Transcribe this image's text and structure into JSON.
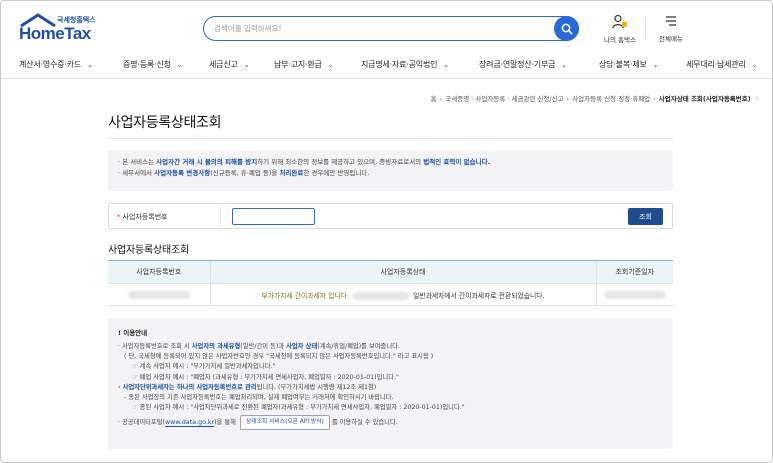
{
  "header": {
    "logo_small": "국세청홈택스",
    "logo_big": "HomeTax",
    "search_placeholder": "검색어를 입력하세요!",
    "my_hometax_label": "나의 홈택스",
    "all_menu_label": "전체메뉴"
  },
  "nav": {
    "items": [
      {
        "label": "계산서·영수증·카드"
      },
      {
        "label": "증명·등록·신청"
      },
      {
        "label": "세금신고"
      },
      {
        "label": "납부·고지·환급"
      },
      {
        "label": "지급명세·자료·공익법인"
      },
      {
        "label": "장려금·연말정산·기부금"
      },
      {
        "label": "상담·불복·제보"
      },
      {
        "label": "세무대리·납세관리"
      }
    ]
  },
  "breadcrumb": {
    "items": [
      "홈",
      "국세증명 · 사업자등록 · 세금관련 신청/신고",
      "사업자등록 신청·정정·휴폐업"
    ],
    "current": "사업자상태 조회(사업자등록번호)"
  },
  "page_title": "사업자등록상태조회",
  "notice": {
    "line1_pre": "· 본 서비스는 ",
    "line1_b1": "사업자간 거래 시 불의의 피해를 방지",
    "line1_mid": "하기 위해 최소한의 정보를 제공하고 있으며, 증빙자료로서의 ",
    "line1_b2": "법적인 효력이 없습니다.",
    "line2_pre": "· 세무서에서 ",
    "line2_b1": "사업자등록 변경사항",
    "line2_mid": "(신규등록, 휴·폐업 등)을 ",
    "line2_b2": "처리완료",
    "line2_post": "한 경우에만 반영됩니다."
  },
  "form": {
    "label": "사업자등록번호",
    "required_mark": "*",
    "input_value": "",
    "submit_label": "조회"
  },
  "result": {
    "section_title": "사업자등록상태조회",
    "columns": [
      "사업자등록번호",
      "사업자등록상태",
      "조회기준일자"
    ],
    "status_pre": "부가가치세 간이과세자 입니다.",
    "status_post": "일반과세자에서 간이과세자로 전환되었습니다."
  },
  "info": {
    "head": "! 이용안내",
    "l1_pre": "· 사업자등록번호로 조회 시 ",
    "l1_b1": "사업자의 과세유형",
    "l1_mid": "(일반/간이 등)과 ",
    "l1_b2": "사업자 상태",
    "l1_post": "(계속/휴업/폐업)를 보여줍니다.",
    "l2": "( 단, 국세청에 등록되어 있지 않은 사업자번호인 경우 \"국세청에 등록되지 않은 사업자등록번호입니다.\" 라고 표시됨 )",
    "l3": "☞ 계속 사업자 예시 : \"부가가치세 일반과세자입니다.\"",
    "l4": "☞ 폐업 사업자 예시 : \"폐업자 (과세유형 : 부가가치세 면세사업자, 폐업일자 : 2020-01-01)입니다.\"",
    "l5_b1": "· 사업자단위과세자는 하나의 사업자등록번호로 관리",
    "l5_post": "됩니다. (부가가치세법 시행령 제12조 제1항)",
    "l6": "- 종된 사업장의 기존 사업자등록번호는 폐업처리되며, 실제 폐업여부는 거래처에 확인하시기 바랍니다.",
    "l7": "☞ 종된 사업자 예시 : \"사업자단위과세로 전환된 폐업자(과세유형 : 부가가치세 면세사업자, 폐업일자 : 2020-01-01)입니다.\"",
    "l8_pre": "· 공공데이터포털(",
    "l8_link": "www.data.go.kr",
    "l8_mid": ")을 통해",
    "l8_btn": "상태조회 서비스(오픈 API 방식)",
    "l8_post": "를 이용하실 수 있습니다."
  },
  "colors": {
    "brand_blue": "#1e4fa5",
    "search_blue": "#2a6ad8",
    "button_navy": "#1f4c8f",
    "table_header": "#eaf3f6"
  }
}
